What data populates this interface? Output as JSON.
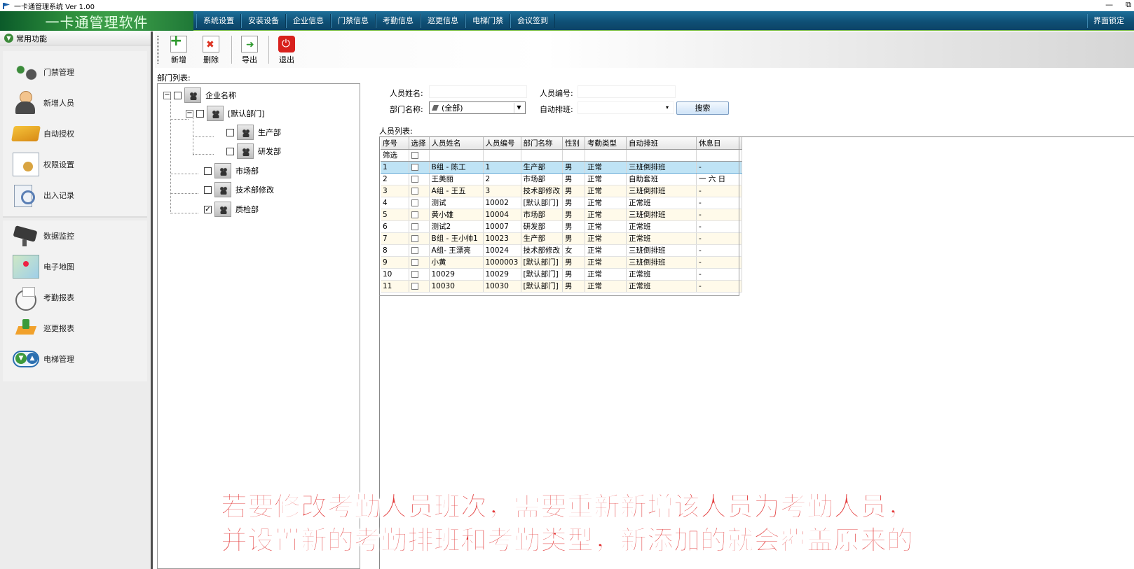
{
  "window": {
    "title": "一卡通管理系统  Ver 1.00",
    "minimize": "—",
    "restore": "⧉"
  },
  "app": {
    "logo": "一卡通管理软件"
  },
  "menu": {
    "items": [
      "系统设置",
      "安装设备",
      "企业信息",
      "门禁信息",
      "考勤信息",
      "巡更信息",
      "电梯门禁",
      "会议签到"
    ],
    "lock": "界面锁定"
  },
  "sidebar": {
    "header": "常用功能",
    "group1": [
      {
        "label": "门禁管理",
        "icon": "door-control-icon"
      },
      {
        "label": "新增人员",
        "icon": "user-icon"
      },
      {
        "label": "自动授权",
        "icon": "card-icon"
      },
      {
        "label": "权限设置",
        "icon": "permission-icon"
      },
      {
        "label": "出入记录",
        "icon": "record-search-icon"
      }
    ],
    "group2": [
      {
        "label": "数据监控",
        "icon": "camera-icon"
      },
      {
        "label": "电子地图",
        "icon": "map-icon"
      },
      {
        "label": "考勤报表",
        "icon": "clock-icon"
      },
      {
        "label": "巡更报表",
        "icon": "patrol-icon"
      },
      {
        "label": "电梯管理",
        "icon": "elevator-icon"
      }
    ]
  },
  "toolbar": {
    "add": "新增",
    "delete": "删除",
    "export": "导出",
    "exit": "退出"
  },
  "dept": {
    "caption": "部门列表:",
    "root": "企业名称",
    "default": "[默认部门]",
    "production": "生产部",
    "rnd": "研发部",
    "market": "市场部",
    "tech": "技术部修改",
    "qc": "质检部",
    "qc_checked": "✓"
  },
  "search": {
    "name_label": "人员姓名:",
    "name_value": "",
    "id_label": "人员编号:",
    "id_value": "",
    "dept_label": "部门名称:",
    "dept_value": "(全部)",
    "shift_label": "自动排班:",
    "shift_value": "",
    "button": "搜索"
  },
  "grid": {
    "caption": "人员列表:",
    "headers": [
      "序号",
      "选择",
      "人员姓名",
      "人员编号",
      "部门名称",
      "性别",
      "考勤类型",
      "自动排班",
      "休息日"
    ],
    "filter_label": "筛选",
    "rows": [
      [
        "1",
        "B组 - 陈工",
        "1",
        "生产部",
        "男",
        "正常",
        "三班倒排班",
        "-"
      ],
      [
        "2",
        "王美丽",
        "2",
        "市场部",
        "男",
        "正常",
        "自助套班",
        "一 六 日"
      ],
      [
        "3",
        "A组 - 王五",
        "3",
        "技术部修改",
        "男",
        "正常",
        "三班倒排班",
        "-"
      ],
      [
        "4",
        "测试",
        "10002",
        "[默认部门]",
        "男",
        "正常",
        "正常班",
        "-"
      ],
      [
        "5",
        "黄小雄",
        "10004",
        "市场部",
        "男",
        "正常",
        "三班倒排班",
        "-"
      ],
      [
        "6",
        "测试2",
        "10007",
        "研发部",
        "男",
        "正常",
        "正常班",
        "-"
      ],
      [
        "7",
        "B组 - 王小帅1",
        "10023",
        "生产部",
        "男",
        "正常",
        "正常班",
        "-"
      ],
      [
        "8",
        "A组- 王漂亮",
        "10024",
        "技术部修改",
        "女",
        "正常",
        "三班倒排班",
        "-"
      ],
      [
        "9",
        "小黄",
        "1000003",
        "[默认部门]",
        "男",
        "正常",
        "三班倒排班",
        "-"
      ],
      [
        "10",
        "10029",
        "10029",
        "[默认部门]",
        "男",
        "正常",
        "正常班",
        "-"
      ],
      [
        "11",
        "10030",
        "10030",
        "[默认部门]",
        "男",
        "正常",
        "正常班",
        "-"
      ]
    ],
    "selected_row": 1
  },
  "subtitle": {
    "line1": "若要修改考勤人员班次，需要重新新增该人员为考勤人员，",
    "line2": "并设置新的考勤排班和考勤类型，新添加的就会覆盖原来的"
  }
}
